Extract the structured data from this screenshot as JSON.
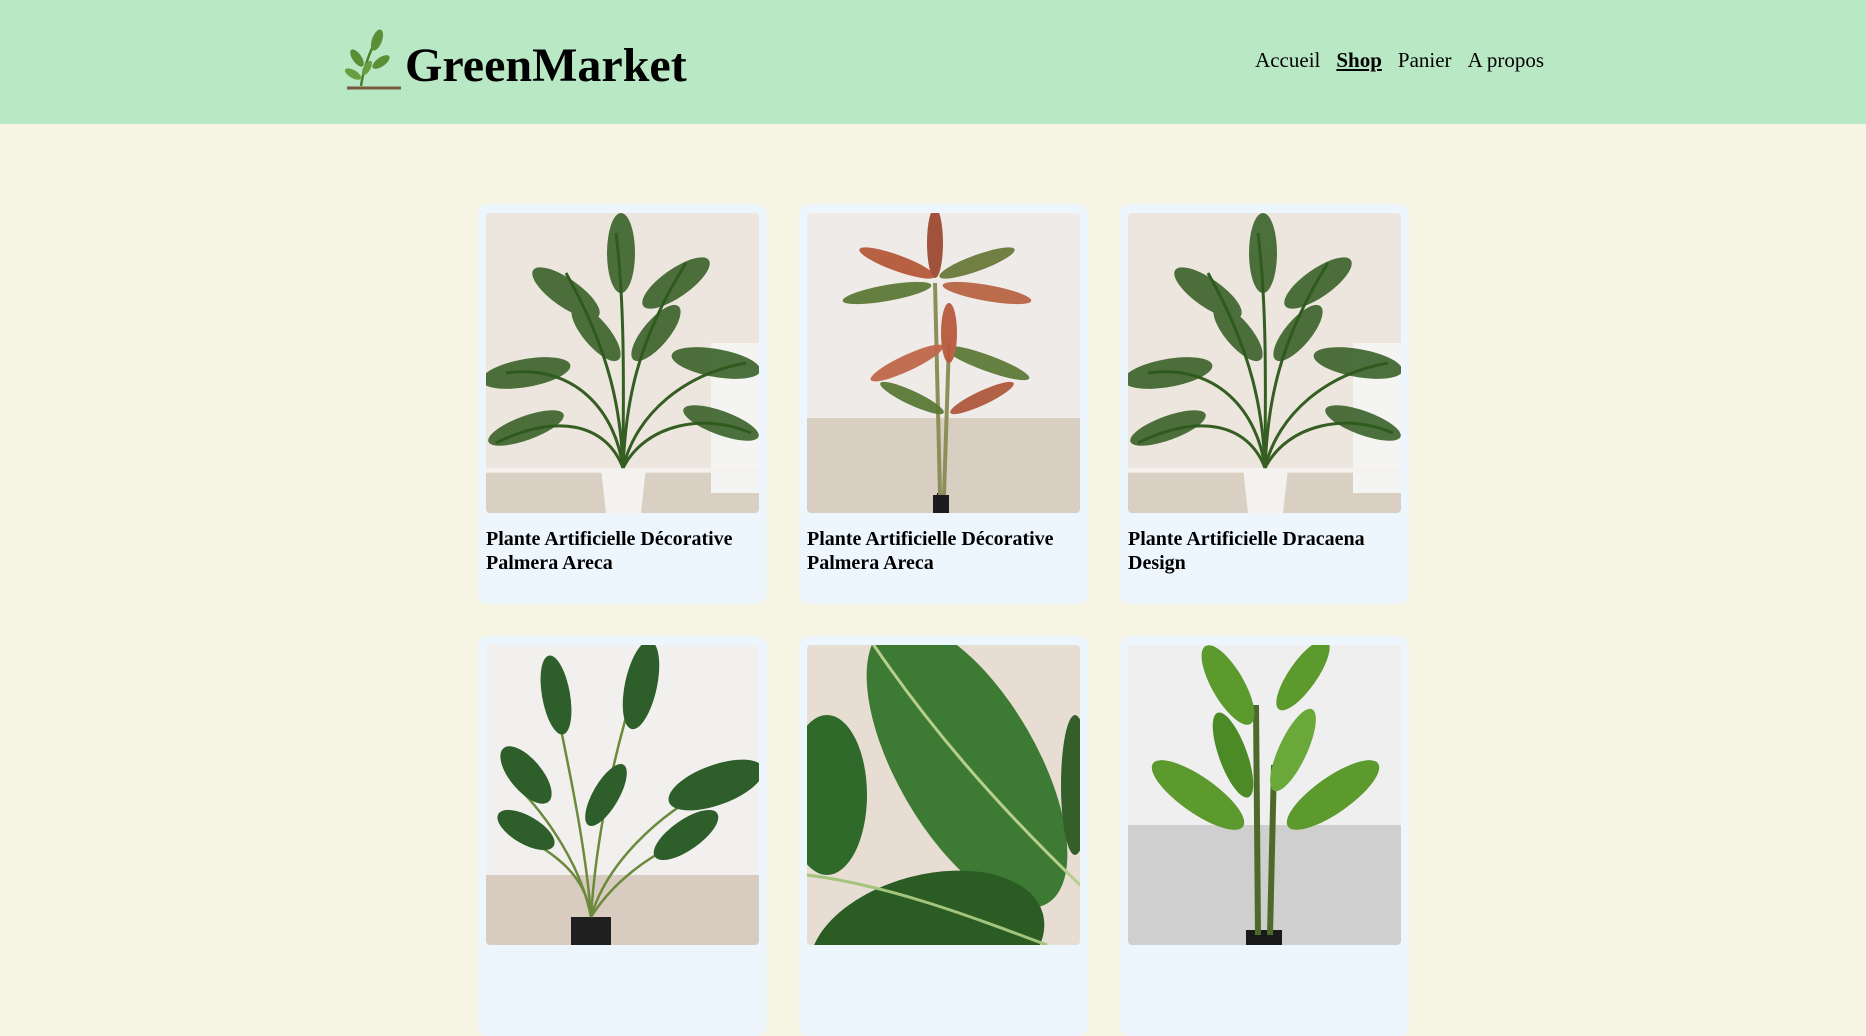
{
  "header": {
    "brand": "GreenMarket",
    "logo_icon": "sprout-icon",
    "nav": [
      {
        "label": "Accueil",
        "active": false
      },
      {
        "label": "Shop",
        "active": true
      },
      {
        "label": "Panier",
        "active": false
      },
      {
        "label": "A propos",
        "active": false
      }
    ]
  },
  "products": [
    {
      "title": "Plante Artificielle Décorative Palmera Areca",
      "image": "palm-plant-image"
    },
    {
      "title": "Plante Artificielle Décorative Palmera Areca",
      "image": "dracaena-plant-image"
    },
    {
      "title": "Plante Artificielle Dracaena Design",
      "image": "palm-plant-image"
    },
    {
      "title": "",
      "image": "strelitzia-plant-image"
    },
    {
      "title": "",
      "image": "leaf-closeup-image"
    },
    {
      "title": "",
      "image": "banana-plant-image"
    }
  ],
  "colors": {
    "header_bg": "#b9e8c4",
    "page_bg": "#f7f6e5",
    "card_bg": "#eef6fd"
  }
}
